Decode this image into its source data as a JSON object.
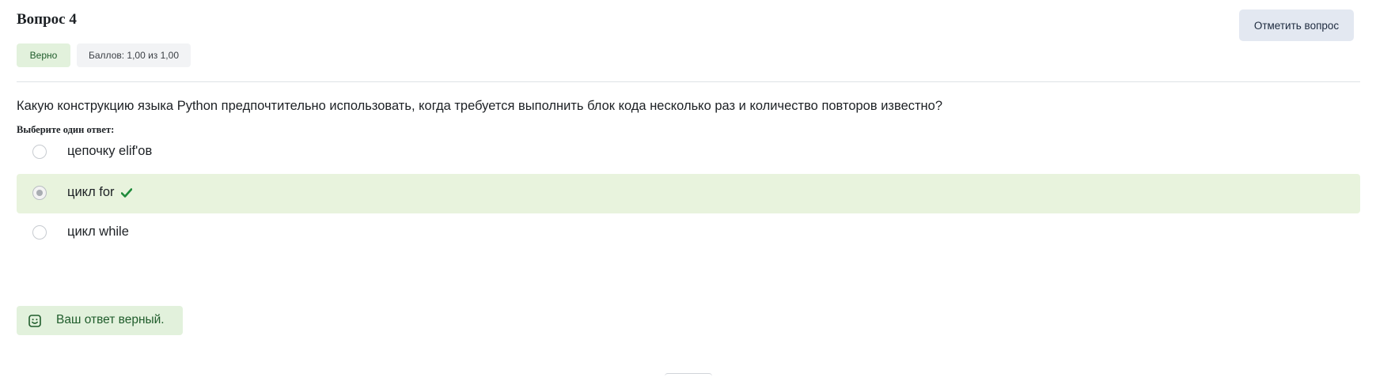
{
  "question": {
    "title": "Вопрос 4",
    "state_badge": "Верно",
    "score_badge": "Баллов: 1,00 из 1,00",
    "flag_button": "Отметить вопрос",
    "text": "Какую конструкцию языка Python предпочтительно использовать, когда требуется выполнить блок кода несколько раз и количество повторов известно?",
    "prompt": "Выберите один ответ:",
    "options": [
      {
        "label": "цепочку elif'ов",
        "selected": false
      },
      {
        "label": "цикл for",
        "selected": true,
        "correct_mark": "check-icon"
      },
      {
        "label": "цикл while",
        "selected": false
      }
    ],
    "feedback": "Ваш ответ верный."
  },
  "colors": {
    "correct_bg": "#e8f3dd",
    "correct_text": "#1f5c2b",
    "check_green": "#1e8a3a",
    "flag_button_bg": "#e3e8f1"
  }
}
